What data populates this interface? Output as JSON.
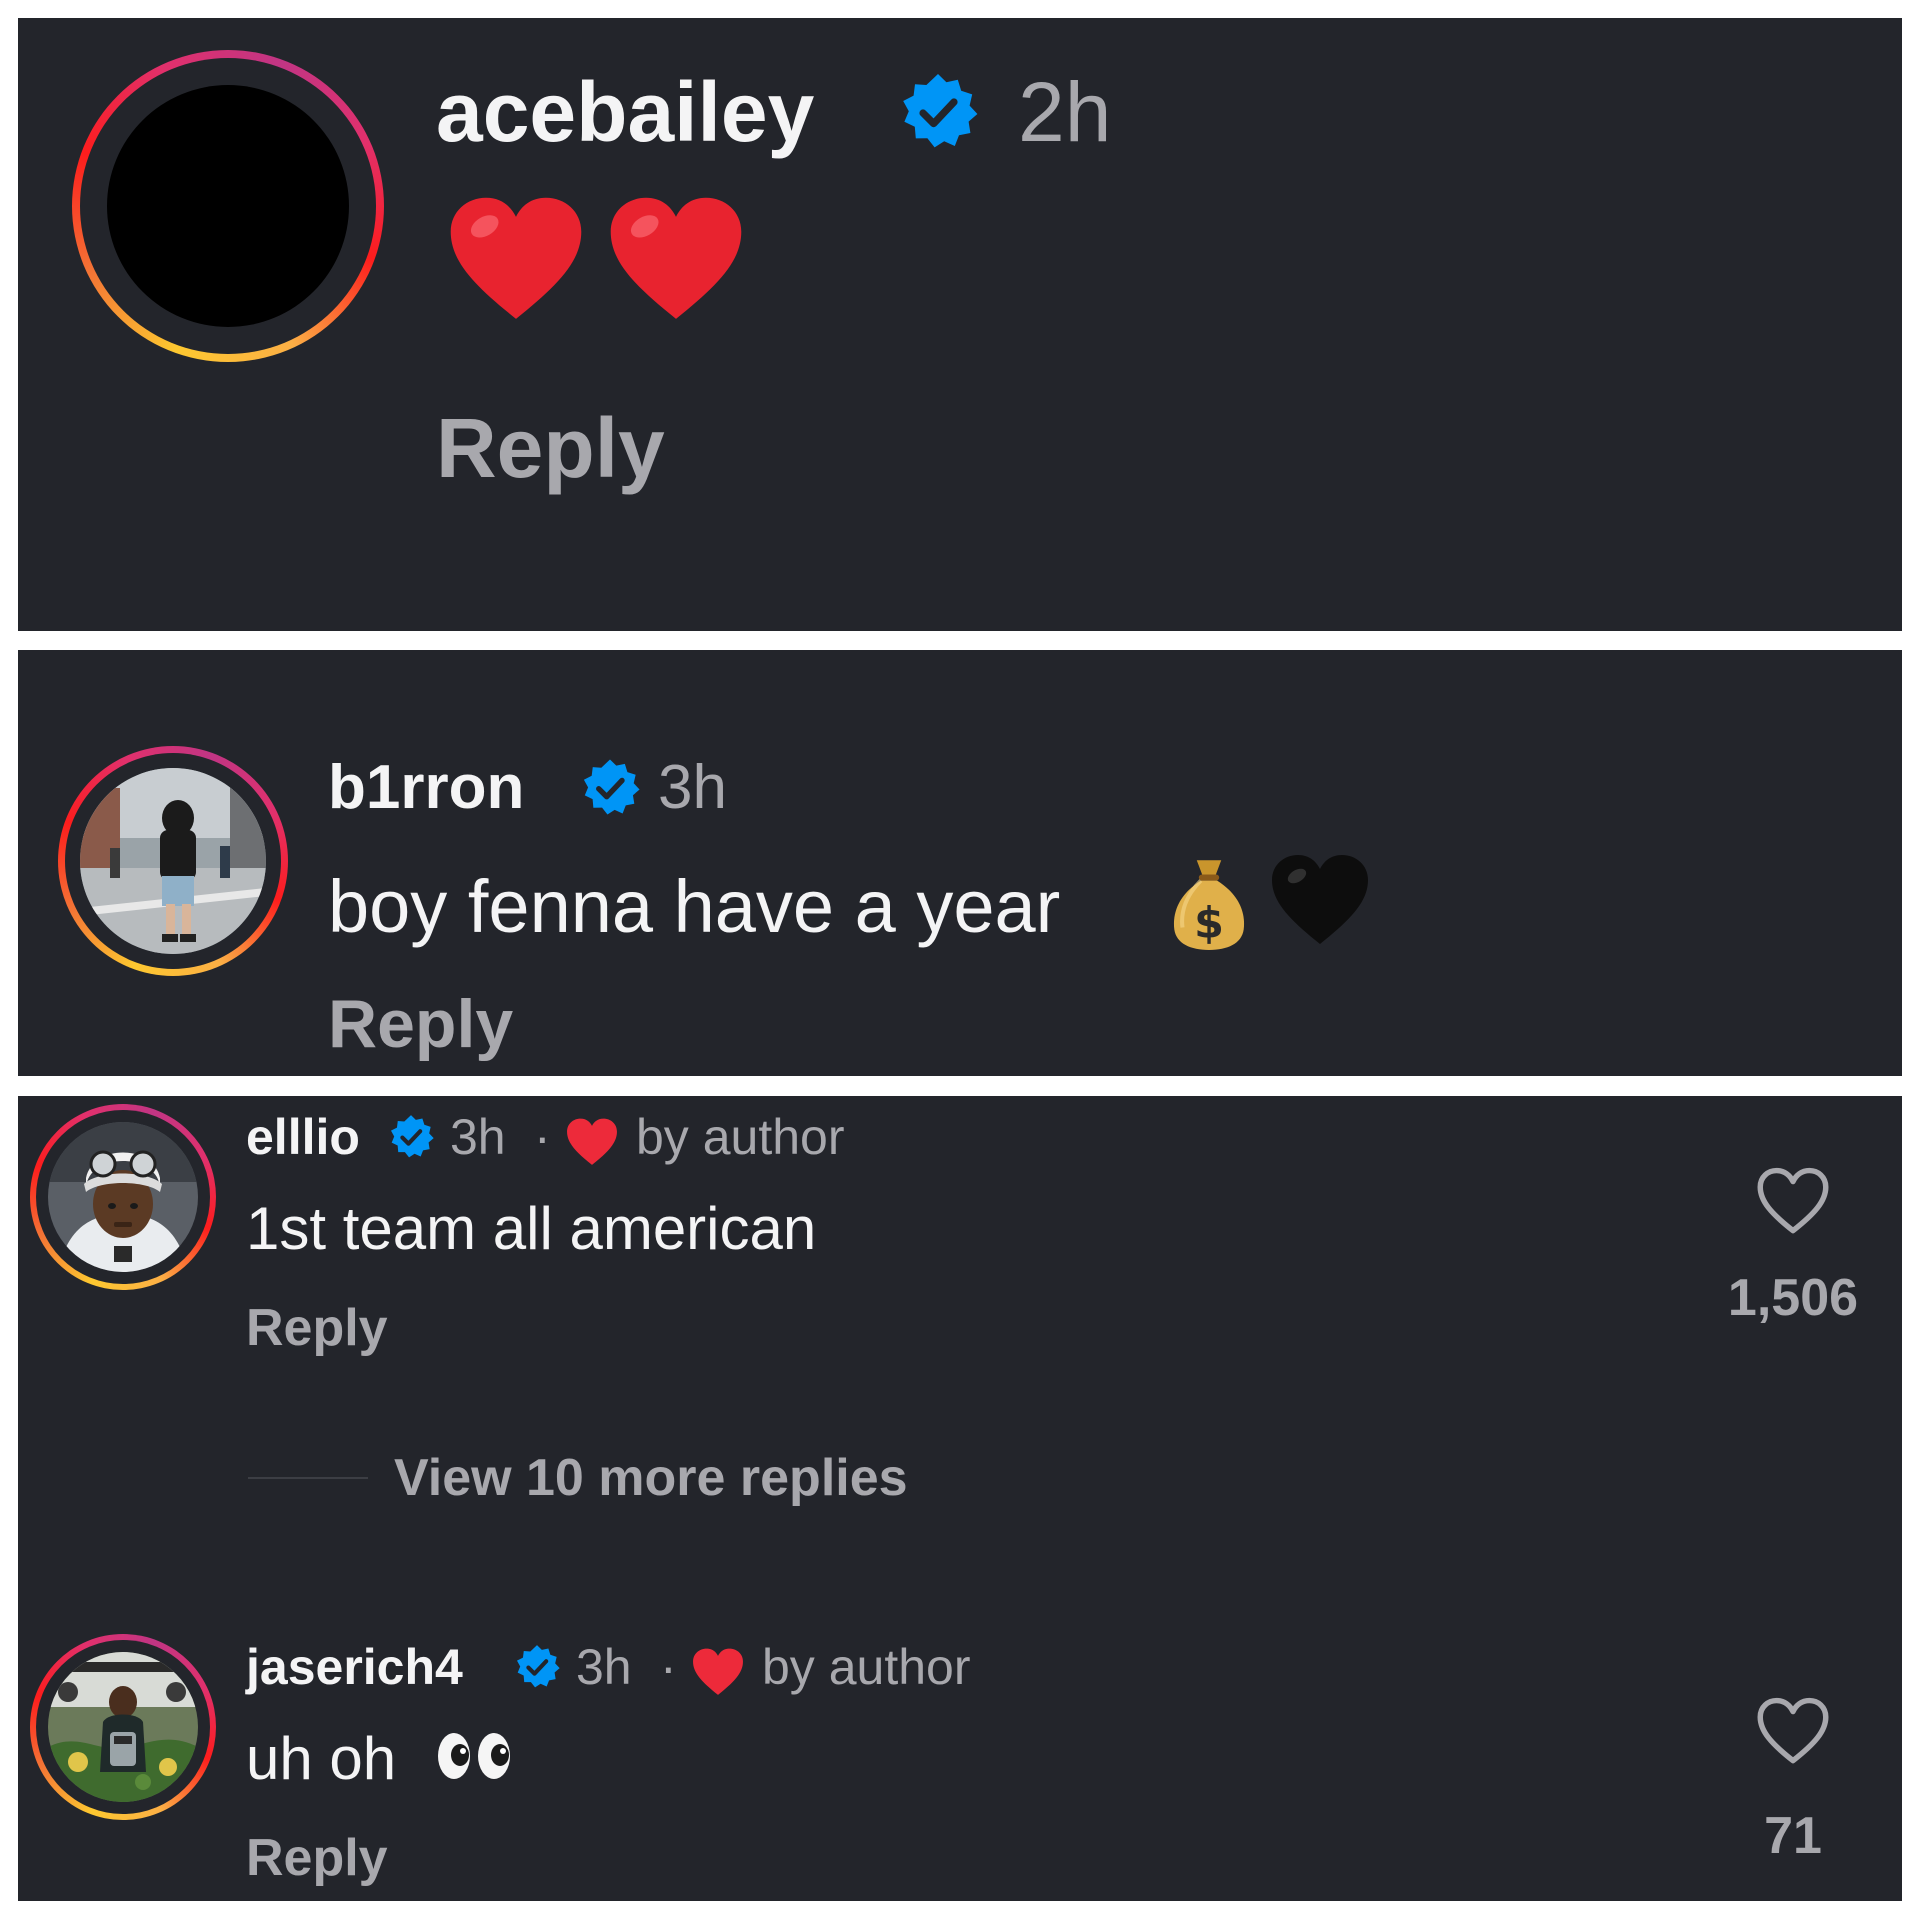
{
  "colors": {
    "panel_bg": "#23252b",
    "text_primary": "#f4f4f5",
    "text_secondary": "#a8a8ad",
    "verified_blue": "#0095f6",
    "heart_red": "#ed4956"
  },
  "comments": [
    {
      "username": "acebailey",
      "verified": true,
      "time": "2h",
      "text": "",
      "emojis": [
        "red-heart",
        "red-heart"
      ],
      "reply_label": "Reply"
    },
    {
      "username": "b1rron",
      "verified": true,
      "time": "3h",
      "text": "boy fenna have a year",
      "emojis": [
        "money-bag",
        "black-heart"
      ],
      "reply_label": "Reply"
    },
    {
      "username": "elllio",
      "verified": true,
      "time": "3h",
      "separator": "·",
      "liked_by_author_label": "by author",
      "text": "1st team all american",
      "reply_label": "Reply",
      "like_count": "1,506",
      "more_replies_label": "View 10 more replies"
    },
    {
      "username": "jaserich4",
      "verified": true,
      "time": "3h",
      "separator": "·",
      "liked_by_author_label": "by author",
      "text": "uh oh",
      "emojis": [
        "eyes"
      ],
      "reply_label": "Reply",
      "like_count": "71"
    }
  ]
}
